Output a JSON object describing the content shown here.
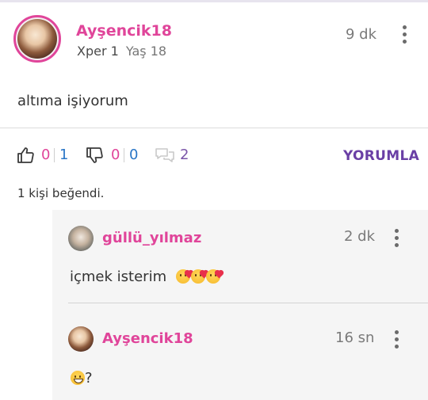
{
  "post": {
    "username": "Ayşencik18",
    "xper": "Xper 1",
    "age": "Yaş 18",
    "time": "9 dk",
    "body": "altıma işiyorum"
  },
  "actions": {
    "like_pink": "0",
    "like_blue": "1",
    "dislike_pink": "0",
    "dislike_blue": "0",
    "comment_count": "2",
    "reply_label": "YORUMLA"
  },
  "likes_text": "1 kişi beğendi.",
  "replies": [
    {
      "username": "güllü_yılmaz",
      "time": "2 dk",
      "body": "içmek isterim",
      "emoji": [
        "kissing-heart-icon",
        "kissing-heart-icon",
        "kissing-heart-icon"
      ]
    },
    {
      "username": "Ayşencik18",
      "time": "16 sn",
      "body": "?",
      "emoji": [
        "grinning-face-icon"
      ]
    }
  ],
  "colors": {
    "brand_pink": "#e0459a",
    "brand_purple": "#6a3fa5",
    "count_blue": "#2a76c6"
  }
}
